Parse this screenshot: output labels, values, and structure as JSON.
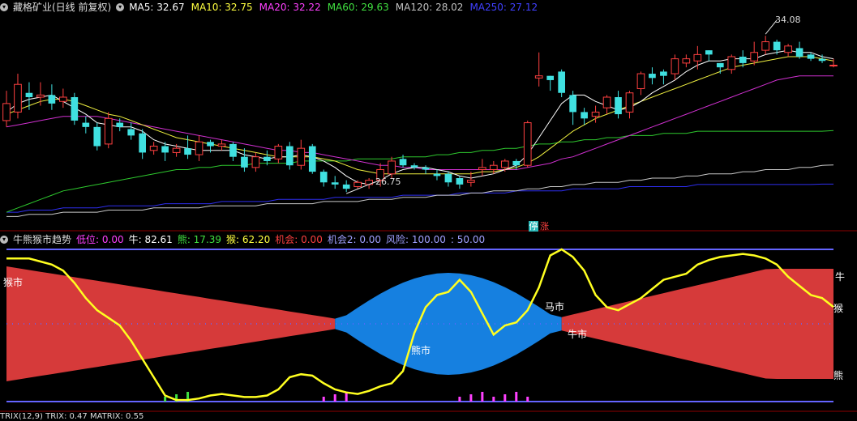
{
  "upper": {
    "title": "藏格矿业(日线 前复权)",
    "ma": [
      {
        "label": "MA5: 32.67",
        "color": "#ffffff"
      },
      {
        "label": "MA10: 32.75",
        "color": "#ffff40"
      },
      {
        "label": "MA20: 32.22",
        "color": "#ff40ff"
      },
      {
        "label": "MA60: 29.63",
        "color": "#40e040"
      },
      {
        "label": "MA120: 28.02",
        "color": "#c0c0c0"
      },
      {
        "label": "MA250: 27.12",
        "color": "#4040ff"
      }
    ],
    "high_label": "34.08",
    "low_label": "26.75",
    "limit_up_badge_1": "停",
    "limit_up_badge_2": "涨"
  },
  "lower": {
    "title": "牛熊猴市趋势",
    "values": [
      {
        "label": "低位: 0.00",
        "color": "#ff40ff"
      },
      {
        "label": "牛: 82.61",
        "color": "#ffffff"
      },
      {
        "label": "熊: 17.39",
        "color": "#40e040"
      },
      {
        "label": "猴: 62.20",
        "color": "#ffff40"
      },
      {
        "label": "机会: 0.00",
        "color": "#ff4040"
      },
      {
        "label": "机会2: 0.00",
        "color": "#a0a0ff"
      },
      {
        "label": "风险: 100.00",
        "color": "#a0a0ff"
      },
      {
        "label": ": 50.00",
        "color": "#a0a0ff"
      }
    ],
    "label_monkey_left": "猴市",
    "label_bear_market": "熊市",
    "label_horse_market": "马市",
    "label_bull_market": "牛市",
    "label_bull_right": "牛",
    "label_monkey_right": "猴",
    "label_bear_right": "熊"
  },
  "bottom": {
    "text": "TRIX(12,9)  TRIX: 0.47  MATRIX: 0.55"
  },
  "chart_data": [
    {
      "type": "candlestick",
      "title": "藏格矿业(日线 前复权)",
      "ylim": [
        25.5,
        35.0
      ],
      "candles": [
        [
          30.1,
          30.9,
          29.8,
          31.5
        ],
        [
          30.5,
          31.8,
          30.2,
          32.3
        ],
        [
          31.4,
          31.2,
          30.6,
          31.9
        ],
        [
          31.2,
          31.3,
          30.8,
          31.9
        ],
        [
          31.3,
          30.9,
          30.6,
          31.8
        ],
        [
          31.0,
          31.2,
          30.7,
          31.6
        ],
        [
          31.2,
          30.1,
          29.9,
          31.4
        ],
        [
          30.0,
          29.8,
          29.5,
          30.3
        ],
        [
          29.8,
          28.9,
          28.7,
          30.0
        ],
        [
          29.0,
          30.2,
          28.8,
          30.5
        ],
        [
          30.0,
          29.8,
          29.6,
          30.2
        ],
        [
          29.7,
          29.4,
          29.2,
          30.0
        ],
        [
          29.5,
          28.6,
          28.3,
          29.7
        ],
        [
          28.7,
          28.9,
          28.5,
          29.1
        ],
        [
          28.9,
          28.6,
          28.2,
          29.1
        ],
        [
          28.6,
          28.8,
          28.4,
          29.0
        ],
        [
          28.8,
          28.5,
          28.3,
          29.4
        ],
        [
          28.5,
          29.1,
          28.2,
          29.4
        ],
        [
          29.1,
          28.9,
          28.6,
          29.2
        ],
        [
          28.9,
          29.0,
          28.7,
          29.2
        ],
        [
          29.0,
          28.4,
          28.2,
          29.1
        ],
        [
          28.4,
          27.9,
          27.7,
          28.8
        ],
        [
          27.9,
          28.4,
          27.7,
          28.6
        ],
        [
          28.4,
          28.2,
          28.0,
          28.7
        ],
        [
          28.3,
          28.9,
          28.1,
          29.0
        ],
        [
          28.9,
          28.0,
          27.8,
          29.1
        ],
        [
          28.0,
          28.8,
          27.8,
          29.2
        ],
        [
          28.9,
          27.7,
          27.6,
          29.0
        ],
        [
          27.7,
          27.2,
          27.0,
          27.8
        ],
        [
          27.2,
          27.1,
          26.9,
          27.5
        ],
        [
          27.1,
          26.9,
          26.75,
          27.3
        ],
        [
          27.0,
          27.2,
          26.9,
          27.3
        ],
        [
          27.1,
          27.3,
          26.9,
          27.4
        ],
        [
          27.3,
          27.8,
          27.0,
          28.1
        ],
        [
          27.6,
          28.2,
          27.4,
          28.4
        ],
        [
          28.3,
          28.0,
          27.9,
          28.5
        ],
        [
          28.0,
          27.9,
          27.8,
          28.1
        ],
        [
          27.9,
          27.8,
          27.6,
          28.0
        ],
        [
          27.6,
          27.5,
          27.3,
          27.8
        ],
        [
          27.6,
          27.2,
          27.0,
          27.7
        ],
        [
          27.4,
          27.1,
          26.9,
          27.5
        ],
        [
          27.2,
          27.3,
          27.0,
          27.7
        ],
        [
          27.8,
          27.9,
          27.5,
          28.3
        ],
        [
          27.8,
          28.0,
          27.6,
          28.2
        ],
        [
          27.9,
          28.2,
          27.7,
          28.3
        ],
        [
          28.2,
          28.0,
          27.8,
          28.3
        ],
        [
          28.0,
          30.0,
          27.9,
          30.1
        ],
        [
          32.1,
          32.2,
          31.7,
          33.3
        ],
        [
          32.2,
          32.0,
          31.5,
          32.2
        ],
        [
          32.4,
          31.4,
          31.2,
          32.5
        ],
        [
          31.3,
          30.5,
          29.9,
          31.5
        ],
        [
          30.5,
          30.2,
          29.9,
          30.7
        ],
        [
          30.3,
          30.5,
          30.0,
          30.8
        ],
        [
          30.7,
          31.2,
          30.4,
          31.3
        ],
        [
          31.2,
          30.4,
          30.2,
          31.5
        ],
        [
          30.5,
          31.4,
          30.2,
          31.5
        ],
        [
          31.6,
          32.3,
          31.3,
          32.4
        ],
        [
          32.3,
          32.1,
          31.8,
          32.6
        ],
        [
          32.4,
          32.2,
          31.8,
          32.5
        ],
        [
          32.3,
          33.0,
          32.0,
          33.2
        ],
        [
          32.8,
          33.0,
          32.6,
          33.2
        ],
        [
          32.9,
          33.2,
          32.5,
          33.6
        ],
        [
          33.4,
          33.2,
          32.9,
          33.4
        ],
        [
          32.8,
          32.6,
          32.3,
          32.8
        ],
        [
          32.5,
          33.1,
          32.3,
          33.2
        ],
        [
          33.1,
          32.8,
          32.6,
          33.4
        ],
        [
          32.9,
          33.3,
          32.7,
          33.8
        ],
        [
          33.4,
          33.8,
          33.2,
          34.08
        ],
        [
          33.8,
          33.4,
          33.2,
          33.9
        ],
        [
          33.3,
          33.6,
          33.1,
          33.7
        ],
        [
          33.5,
          33.1,
          33.0,
          33.8
        ],
        [
          33.2,
          33.0,
          32.9,
          33.3
        ],
        [
          33.0,
          32.9,
          32.8,
          33.2
        ],
        [
          32.7,
          32.7,
          32.6,
          33.0
        ]
      ],
      "ma5": [
        30.5,
        30.9,
        31.1,
        31.2,
        31.3,
        31.0,
        30.7,
        30.4,
        30.0,
        29.9,
        29.8,
        29.8,
        29.6,
        29.2,
        29.0,
        28.9,
        28.8,
        28.7,
        28.7,
        28.7,
        28.7,
        28.5,
        28.4,
        28.3,
        28.4,
        28.4,
        28.5,
        28.4,
        28.2,
        27.9,
        27.5,
        27.2,
        27.1,
        27.3,
        27.6,
        27.8,
        27.9,
        27.9,
        27.8,
        27.7,
        27.5,
        27.4,
        27.5,
        27.6,
        27.8,
        28.0,
        28.5,
        29.3,
        30.1,
        30.9,
        31.3,
        31.3,
        31.0,
        30.8,
        30.6,
        30.7,
        31.0,
        31.4,
        31.7,
        32.0,
        32.4,
        32.7,
        32.9,
        32.9,
        33.0,
        33.0,
        33.0,
        33.2,
        33.3,
        33.4,
        33.3,
        33.3,
        33.1,
        33.0
      ],
      "ma10": [
        30.4,
        30.6,
        30.8,
        31.0,
        31.1,
        31.1,
        31.0,
        30.8,
        30.6,
        30.4,
        30.3,
        30.1,
        29.9,
        29.7,
        29.5,
        29.3,
        29.2,
        29.1,
        29.0,
        28.9,
        28.8,
        28.7,
        28.6,
        28.5,
        28.4,
        28.4,
        28.4,
        28.4,
        28.3,
        28.2,
        28.0,
        27.8,
        27.7,
        27.6,
        27.6,
        27.6,
        27.6,
        27.6,
        27.6,
        27.6,
        27.6,
        27.6,
        27.7,
        27.7,
        27.8,
        27.9,
        28.1,
        28.4,
        28.8,
        29.2,
        29.6,
        29.9,
        30.2,
        30.4,
        30.6,
        30.8,
        31.0,
        31.2,
        31.4,
        31.6,
        31.8,
        32.0,
        32.2,
        32.4,
        32.6,
        32.7,
        32.8,
        32.9,
        33.0,
        33.1,
        33.1,
        33.1,
        33.0,
        32.9
      ],
      "ma20": [
        29.8,
        29.9,
        30.0,
        30.1,
        30.2,
        30.3,
        30.3,
        30.3,
        30.3,
        30.2,
        30.1,
        30.0,
        29.9,
        29.8,
        29.7,
        29.6,
        29.5,
        29.4,
        29.3,
        29.2,
        29.1,
        29.0,
        28.9,
        28.8,
        28.7,
        28.7,
        28.6,
        28.6,
        28.5,
        28.4,
        28.3,
        28.2,
        28.1,
        28.0,
        28.0,
        27.9,
        27.9,
        27.8,
        27.8,
        27.8,
        27.8,
        27.8,
        27.8,
        27.8,
        27.8,
        27.8,
        27.9,
        28.0,
        28.1,
        28.3,
        28.4,
        28.6,
        28.8,
        29.0,
        29.2,
        29.4,
        29.6,
        29.8,
        30.0,
        30.2,
        30.4,
        30.6,
        30.8,
        31.0,
        31.2,
        31.4,
        31.6,
        31.8,
        32.0,
        32.1,
        32.2,
        32.2,
        32.2,
        32.2
      ],
      "ma60": [
        25.8,
        26.0,
        26.2,
        26.4,
        26.6,
        26.8,
        26.9,
        27.0,
        27.1,
        27.2,
        27.3,
        27.4,
        27.5,
        27.6,
        27.7,
        27.8,
        27.8,
        27.9,
        27.9,
        28.0,
        28.0,
        28.0,
        28.1,
        28.1,
        28.1,
        28.1,
        28.2,
        28.2,
        28.2,
        28.2,
        28.2,
        28.3,
        28.3,
        28.3,
        28.3,
        28.4,
        28.4,
        28.4,
        28.5,
        28.5,
        28.6,
        28.6,
        28.7,
        28.7,
        28.8,
        28.8,
        28.9,
        29.0,
        29.0,
        29.1,
        29.1,
        29.2,
        29.2,
        29.3,
        29.3,
        29.4,
        29.4,
        29.4,
        29.5,
        29.5,
        29.5,
        29.6,
        29.6,
        29.6,
        29.6,
        29.6,
        29.6,
        29.6,
        29.6,
        29.6,
        29.6,
        29.6,
        29.6,
        29.63
      ],
      "ma120": [
        25.6,
        25.6,
        25.7,
        25.7,
        25.7,
        25.8,
        25.8,
        25.8,
        25.8,
        25.9,
        25.9,
        25.9,
        25.9,
        26.0,
        26.0,
        26.0,
        26.0,
        26.0,
        26.1,
        26.1,
        26.1,
        26.1,
        26.1,
        26.2,
        26.2,
        26.2,
        26.2,
        26.2,
        26.3,
        26.3,
        26.3,
        26.3,
        26.4,
        26.4,
        26.4,
        26.5,
        26.5,
        26.5,
        26.6,
        26.6,
        26.6,
        26.7,
        26.7,
        26.8,
        26.8,
        26.8,
        26.9,
        26.9,
        27.0,
        27.0,
        27.1,
        27.1,
        27.2,
        27.2,
        27.2,
        27.3,
        27.3,
        27.4,
        27.4,
        27.4,
        27.5,
        27.5,
        27.6,
        27.6,
        27.6,
        27.7,
        27.7,
        27.8,
        27.8,
        27.8,
        27.9,
        27.9,
        28.0,
        28.02
      ],
      "ma250": [
        25.8,
        25.8,
        25.9,
        25.9,
        25.9,
        26.0,
        26.0,
        26.0,
        26.0,
        26.1,
        26.1,
        26.1,
        26.1,
        26.1,
        26.2,
        26.2,
        26.2,
        26.2,
        26.2,
        26.3,
        26.3,
        26.3,
        26.3,
        26.3,
        26.4,
        26.4,
        26.4,
        26.4,
        26.4,
        26.5,
        26.5,
        26.5,
        26.5,
        26.5,
        26.5,
        26.6,
        26.6,
        26.6,
        26.6,
        26.6,
        26.7,
        26.7,
        26.7,
        26.7,
        26.7,
        26.8,
        26.8,
        26.8,
        26.8,
        26.8,
        26.9,
        26.9,
        26.9,
        26.9,
        26.9,
        27.0,
        27.0,
        27.0,
        27.0,
        27.0,
        27.0,
        27.1,
        27.1,
        27.1,
        27.1,
        27.1,
        27.1,
        27.1,
        27.1,
        27.1,
        27.1,
        27.1,
        27.12,
        27.12
      ]
    },
    {
      "type": "area",
      "title": "牛熊猴市趋势",
      "ylim": [
        0,
        100
      ],
      "monkey_line": [
        94,
        94,
        94,
        92,
        90,
        86,
        78,
        68,
        60,
        55,
        50,
        40,
        28,
        16,
        4,
        1,
        1,
        2,
        4,
        5,
        4,
        3,
        3,
        4,
        8,
        16,
        18,
        17,
        12,
        8,
        6,
        5,
        7,
        10,
        12,
        20,
        45,
        62,
        70,
        72,
        80,
        72,
        58,
        44,
        50,
        52,
        60,
        75,
        96,
        100,
        95,
        86,
        70,
        62,
        60,
        64,
        68,
        74,
        80,
        82,
        84,
        90,
        93,
        95,
        96,
        97,
        96,
        94,
        90,
        82,
        76,
        70,
        68,
        62.2
      ],
      "midline": 50,
      "bull_strength": [
        82.61
      ],
      "bear_strength": [
        17.39
      ]
    }
  ]
}
